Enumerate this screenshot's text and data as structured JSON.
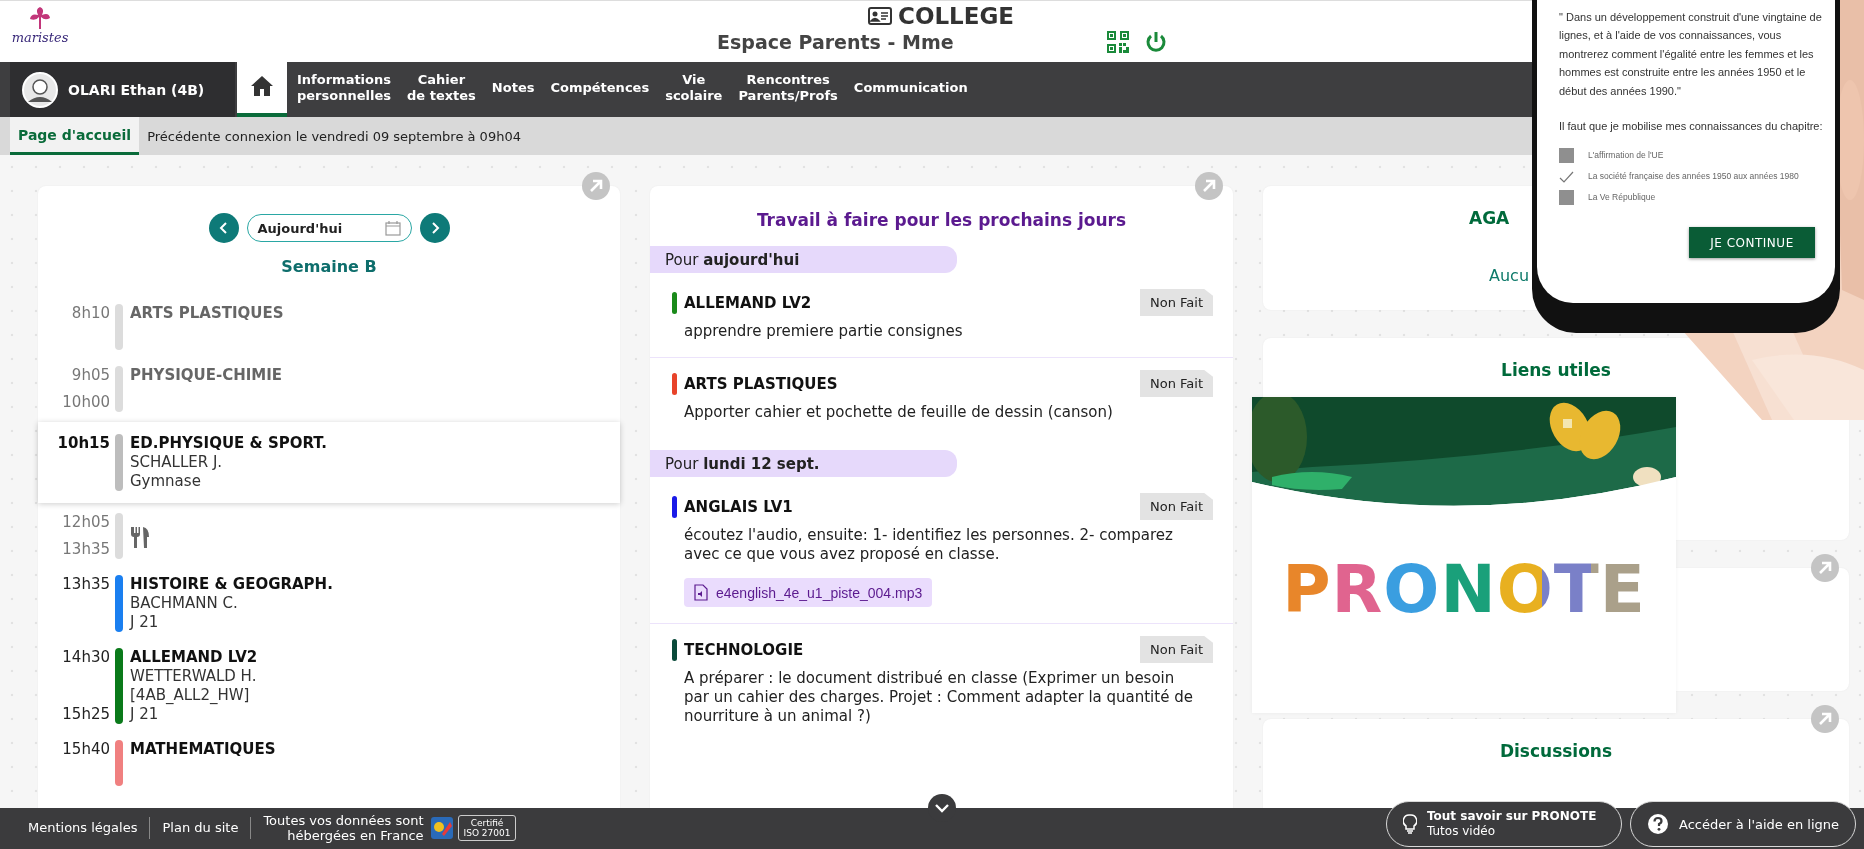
{
  "header": {
    "logo_text": "maristes",
    "title": "COLLEGE",
    "subtitle": "Espace Parents - Mme"
  },
  "user": {
    "name": "OLARI Ethan (4B)"
  },
  "nav": [
    {
      "kind": "home",
      "selected": true
    },
    {
      "kind": "text",
      "label": "Informations\npersonnelles",
      "selected": false
    },
    {
      "kind": "text",
      "label": "Cahier\nde textes",
      "selected": false
    },
    {
      "kind": "text",
      "label": "Notes",
      "selected": false
    },
    {
      "kind": "text",
      "label": "Compétences",
      "selected": false
    },
    {
      "kind": "text",
      "label": "Vie\nscolaire",
      "selected": false
    },
    {
      "kind": "text",
      "label": "Rencontres\nParents/Profs",
      "selected": false
    },
    {
      "kind": "text",
      "label": "Communication",
      "selected": false
    }
  ],
  "subbar": {
    "tab": {
      "label": "Page d'accueil",
      "selected": true
    },
    "last_login": "Précédente connexion le vendredi 09 septembre à 09h04"
  },
  "timetable": {
    "date_field": "Aujourd'hui",
    "week": "Semaine B",
    "lessons": [
      {
        "kind": "lesson",
        "start": "8h10",
        "subject": "ARTS PLASTIQUES",
        "color": "#dcdcdc",
        "past": true,
        "current": false
      },
      {
        "kind": "lesson",
        "start": "9h05",
        "end": "10h00",
        "subject": "PHYSIQUE-CHIMIE",
        "color": "#dcdcdc",
        "past": true,
        "current": false
      },
      {
        "kind": "lesson",
        "start": "10h15",
        "subject": "ED.PHYSIQUE & SPORT.",
        "details": [
          "SCHALLER J.",
          "Gymnase"
        ],
        "color": "#bdbdbd",
        "past": false,
        "current": true
      },
      {
        "kind": "meal",
        "start": "12h05",
        "end": "13h35",
        "color": "#dcdcdc",
        "past": true,
        "current": false
      },
      {
        "kind": "lesson",
        "start": "13h35",
        "subject": "HISTOIRE & GEOGRAPH.",
        "details": [
          "BACHMANN C.",
          "J 21"
        ],
        "color": "#1a7ff0",
        "past": false,
        "current": false
      },
      {
        "kind": "lesson",
        "start": "14h30",
        "end": "15h25",
        "subject": "ALLEMAND LV2",
        "details": [
          "WETTERWALD H.",
          "[4AB_ALL2_HW]",
          "J 21"
        ],
        "color": "#0a7a1a",
        "past": false,
        "current": false
      },
      {
        "kind": "lesson",
        "start": "15h40",
        "subject": "MATHEMATIQUES",
        "color": "#f08080",
        "past": false,
        "current": false
      }
    ]
  },
  "homework": {
    "title": "Travail à faire pour les prochains jours",
    "groups": [
      {
        "label": "Pour **aujourd'hui**",
        "items": [
          {
            "subject": "ALLEMAND LV2",
            "color": "#1a8a1a",
            "status": "Non Fait",
            "text": "apprendre premiere partie consignes"
          },
          {
            "subject": "ARTS PLASTIQUES",
            "color": "#e8432a",
            "status": "Non Fait",
            "text": "Apporter cahier et pochette de feuille de dessin (canson)"
          }
        ]
      },
      {
        "label": "Pour **lundi 12 sept.**",
        "items": [
          {
            "subject": "ANGLAIS LV1",
            "color": "#1a1ae8",
            "status": "Non Fait",
            "text": "écoutez l'audio, ensuite: 1- identifiez les personnes. 2- comparez avec ce que vous avez proposé en classe.",
            "attachment": "e4english_4e_u1_piste_004.mp3"
          },
          {
            "subject": "TECHNOLOGIE",
            "color": "#0a4a3a",
            "status": "Non Fait",
            "text": "A préparer : le document distribué en classe (Exprimer un besoin par un cahier des charges. Projet : Comment adapter la quantité de nourriture à un animal ?)"
          }
        ]
      }
    ]
  },
  "right_cards": [
    {
      "kind": "agenda",
      "title": "AGA",
      "text": "Aucu"
    },
    {
      "kind": "links",
      "title": "Liens utiles"
    },
    {
      "kind": "blank"
    },
    {
      "kind": "discussions",
      "title": "Discussions"
    }
  ],
  "banner": {
    "text": "PRONOTE"
  },
  "phone": {
    "quote": "\" Dans un développement construit d'une vingtaine de lignes, et à l'aide de vos connaissances, vous montrerez comment l'égalité entre les femmes et les hommes est construite entre les années 1950 et le début des années 1990.\"",
    "prompt": "Il faut que je mobilise mes connaissances du chapitre:",
    "options": [
      {
        "label": "L'affirmation de l'UE",
        "checked": false
      },
      {
        "label": "La société française des années 1950 aux années 1980",
        "checked": true
      },
      {
        "label": "La Ve République",
        "checked": false
      }
    ],
    "button": "JE CONTINUE"
  },
  "footer": {
    "links": [
      "Mentions légales",
      "Plan du site"
    ],
    "hosting": "Toutes vos données sont\nhébergées en France",
    "certification": "Certifié\nISO 27001",
    "help_buttons": [
      {
        "kind": "tutorial",
        "title": "Tout savoir sur PRONOTE",
        "subtitle": "Tutos vidéo"
      },
      {
        "kind": "help",
        "title": "Accéder à l'aide en ligne"
      }
    ]
  }
}
